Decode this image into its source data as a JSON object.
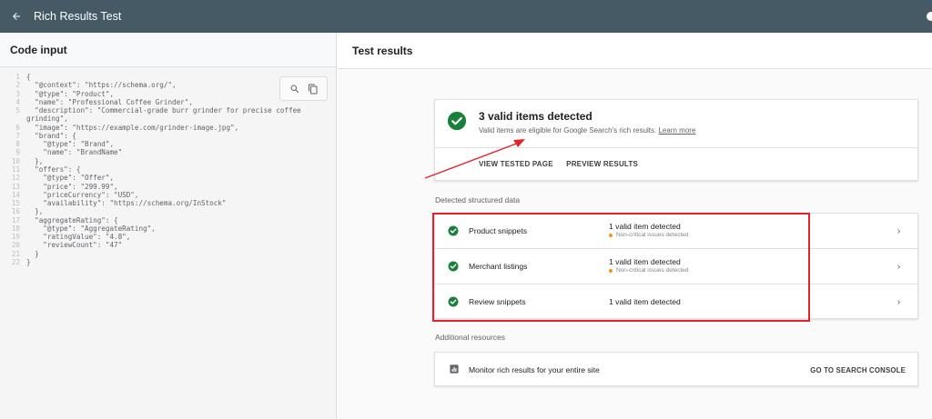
{
  "app": {
    "title": "Rich Results Test"
  },
  "colors": {
    "topbar": "#455a64",
    "success": "#188038",
    "warning": "#f29900",
    "annotation": "#e3222b"
  },
  "icons": {
    "back": "arrow-left-icon",
    "search": "search-icon",
    "copy": "copy-icon",
    "check": "check-circle-icon",
    "chevron": "chevron-right-icon",
    "console": "bar-chart-icon"
  },
  "code_panel": {
    "title": "Code input",
    "lines": [
      {
        "n": "1",
        "t": "{"
      },
      {
        "n": "2",
        "t": "  \"@context\": \"https://schema.org/\","
      },
      {
        "n": "3",
        "t": "  \"@type\": \"Product\","
      },
      {
        "n": "4",
        "t": "  \"name\": \"Professional Coffee Grinder\","
      },
      {
        "n": "5",
        "t": "  \"description\": \"Commercial-grade burr grinder for precise coffee grinding\","
      },
      {
        "n": "6",
        "t": "  \"image\": \"https://example.com/grinder-image.jpg\","
      },
      {
        "n": "7",
        "t": "  \"brand\": {"
      },
      {
        "n": "8",
        "t": "    \"@type\": \"Brand\","
      },
      {
        "n": "9",
        "t": "    \"name\": \"BrandName\""
      },
      {
        "n": "10",
        "t": "  },"
      },
      {
        "n": "11",
        "t": "  \"offers\": {"
      },
      {
        "n": "12",
        "t": "    \"@type\": \"Offer\","
      },
      {
        "n": "13",
        "t": "    \"price\": \"299.99\","
      },
      {
        "n": "14",
        "t": "    \"priceCurrency\": \"USD\","
      },
      {
        "n": "15",
        "t": "    \"availability\": \"https://schema.org/InStock\""
      },
      {
        "n": "16",
        "t": "  },"
      },
      {
        "n": "17",
        "t": "  \"aggregateRating\": {"
      },
      {
        "n": "18",
        "t": "    \"@type\": \"AggregateRating\","
      },
      {
        "n": "19",
        "t": "    \"ratingValue\": \"4.8\","
      },
      {
        "n": "20",
        "t": "    \"reviewCount\": \"47\""
      },
      {
        "n": "21",
        "t": "  }"
      },
      {
        "n": "22",
        "t": "}"
      }
    ]
  },
  "results": {
    "title": "Test results",
    "summary": {
      "headline": "3 valid items detected",
      "subtitle": "Valid items are eligible for Google Search's rich results.",
      "learn_more": "Learn more",
      "view_tested": "VIEW TESTED PAGE",
      "preview": "PREVIEW RESULTS"
    },
    "detected_label": "Detected structured data",
    "items": [
      {
        "name": "Product snippets",
        "status": "1 valid item detected",
        "warning": "Non-critical issues detected"
      },
      {
        "name": "Merchant listings",
        "status": "1 valid item detected",
        "warning": "Non-critical issues detected"
      },
      {
        "name": "Review snippets",
        "status": "1 valid item detected",
        "warning": ""
      }
    ],
    "additional_label": "Additional resources",
    "resource": {
      "text": "Monitor rich results for your entire site",
      "link": "GO TO SEARCH CONSOLE"
    }
  }
}
